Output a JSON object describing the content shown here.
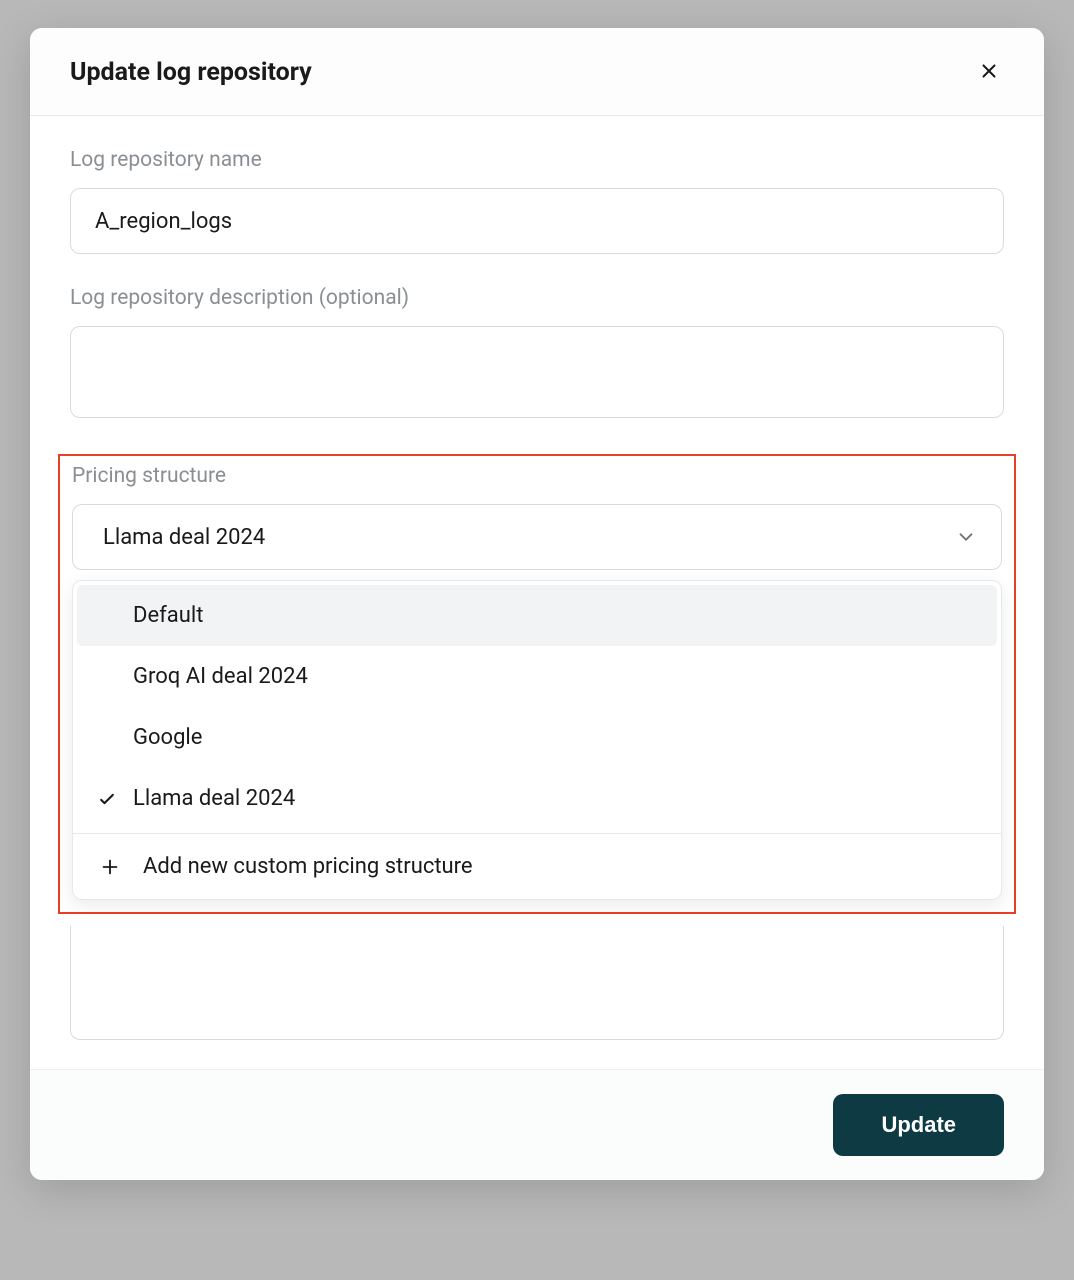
{
  "modal": {
    "title": "Update log repository",
    "fields": {
      "name": {
        "label": "Log repository name",
        "value": "A_region_logs"
      },
      "description": {
        "label": "Log repository description (optional)",
        "value": ""
      },
      "pricing": {
        "label": "Pricing structure",
        "selected": "Llama deal 2024",
        "options": [
          {
            "label": "Default",
            "selected": false,
            "hover": true
          },
          {
            "label": "Groq AI deal 2024",
            "selected": false,
            "hover": false
          },
          {
            "label": "Google",
            "selected": false,
            "hover": false
          },
          {
            "label": "Llama deal 2024",
            "selected": true,
            "hover": false
          }
        ],
        "add_label": "Add new custom pricing structure"
      }
    },
    "footer": {
      "update_label": "Update"
    }
  }
}
